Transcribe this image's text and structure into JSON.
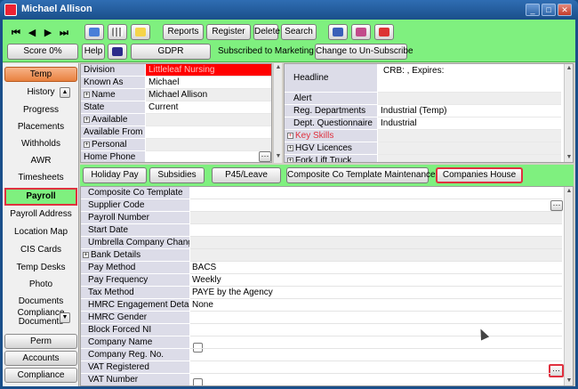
{
  "window": {
    "title": "Michael Allison"
  },
  "toolbar": {
    "buttons": [
      "Reports",
      "Register",
      "Delete",
      "Search"
    ],
    "score": "Score 0%",
    "help": "Help",
    "gdpr": "GDPR",
    "subscribed_text": "Subscribed to Marketing mailings",
    "unsubscribe": "Change to Un-Subscribe"
  },
  "sidebar": {
    "temp": "Temp",
    "items": [
      "History",
      "Progress",
      "Placements",
      "Withholds",
      "AWR",
      "Timesheets",
      "Payroll",
      "Payroll Address",
      "Location Map",
      "CIS Cards",
      "Temp Desks",
      "Photo",
      "Documents",
      "Compliance Documents"
    ],
    "perm": "Perm",
    "accounts": "Accounts",
    "compliance": "Compliance"
  },
  "summary_left": [
    {
      "label": "Division",
      "value": "Littleleaf Nursing"
    },
    {
      "label": "Known As",
      "value": "Michael"
    },
    {
      "label": "Name",
      "value": "Michael Allison"
    },
    {
      "label": "State",
      "value": "Current"
    },
    {
      "label": "Available",
      "value": ""
    },
    {
      "label": "Available From",
      "value": ""
    },
    {
      "label": "Personal",
      "value": ""
    },
    {
      "label": "Home Phone",
      "value": ""
    }
  ],
  "summary_right": {
    "headline_label": "Headline",
    "headline_value": "CRB: , Expires:",
    "rows": [
      {
        "label": "Alert",
        "value": ""
      },
      {
        "label": "Reg. Departments",
        "value": "Industrial (Temp)"
      },
      {
        "label": "Dept. Questionnaire",
        "value": "Industrial"
      },
      {
        "label": "Key Skills",
        "value": ""
      },
      {
        "label": "HGV Licences",
        "value": ""
      },
      {
        "label": "Fork Lift Truck",
        "value": ""
      }
    ]
  },
  "tabs": [
    "Holiday Pay",
    "Subsidies",
    "P45/Leave",
    "Composite Co Template Maintenance",
    "Companies House"
  ],
  "details": [
    {
      "label": "Composite Co Template",
      "value": ""
    },
    {
      "label": "Supplier Code",
      "value": ""
    },
    {
      "label": "Payroll Number",
      "value": ""
    },
    {
      "label": "Start Date",
      "value": ""
    },
    {
      "label": "Umbrella Company Changed",
      "value": ""
    },
    {
      "label": "Bank Details",
      "value": ""
    },
    {
      "label": "Pay Method",
      "value": "BACS"
    },
    {
      "label": "Pay Frequency",
      "value": "Weekly"
    },
    {
      "label": "Tax Method",
      "value": "PAYE by the Agency"
    },
    {
      "label": "HMRC Engagement Detail",
      "value": "None"
    },
    {
      "label": "HMRC Gender",
      "value": ""
    },
    {
      "label": "Block Forced NI",
      "value": ""
    },
    {
      "label": "Company Name",
      "value": ""
    },
    {
      "label": "Company Reg. No.",
      "value": ""
    },
    {
      "label": "VAT Registered",
      "value": ""
    },
    {
      "label": "VAT Number",
      "value": ""
    }
  ],
  "colors": {
    "accent_green": "#7ff07f",
    "highlight_red": "#e0313f",
    "division_red": "#ff0000"
  }
}
